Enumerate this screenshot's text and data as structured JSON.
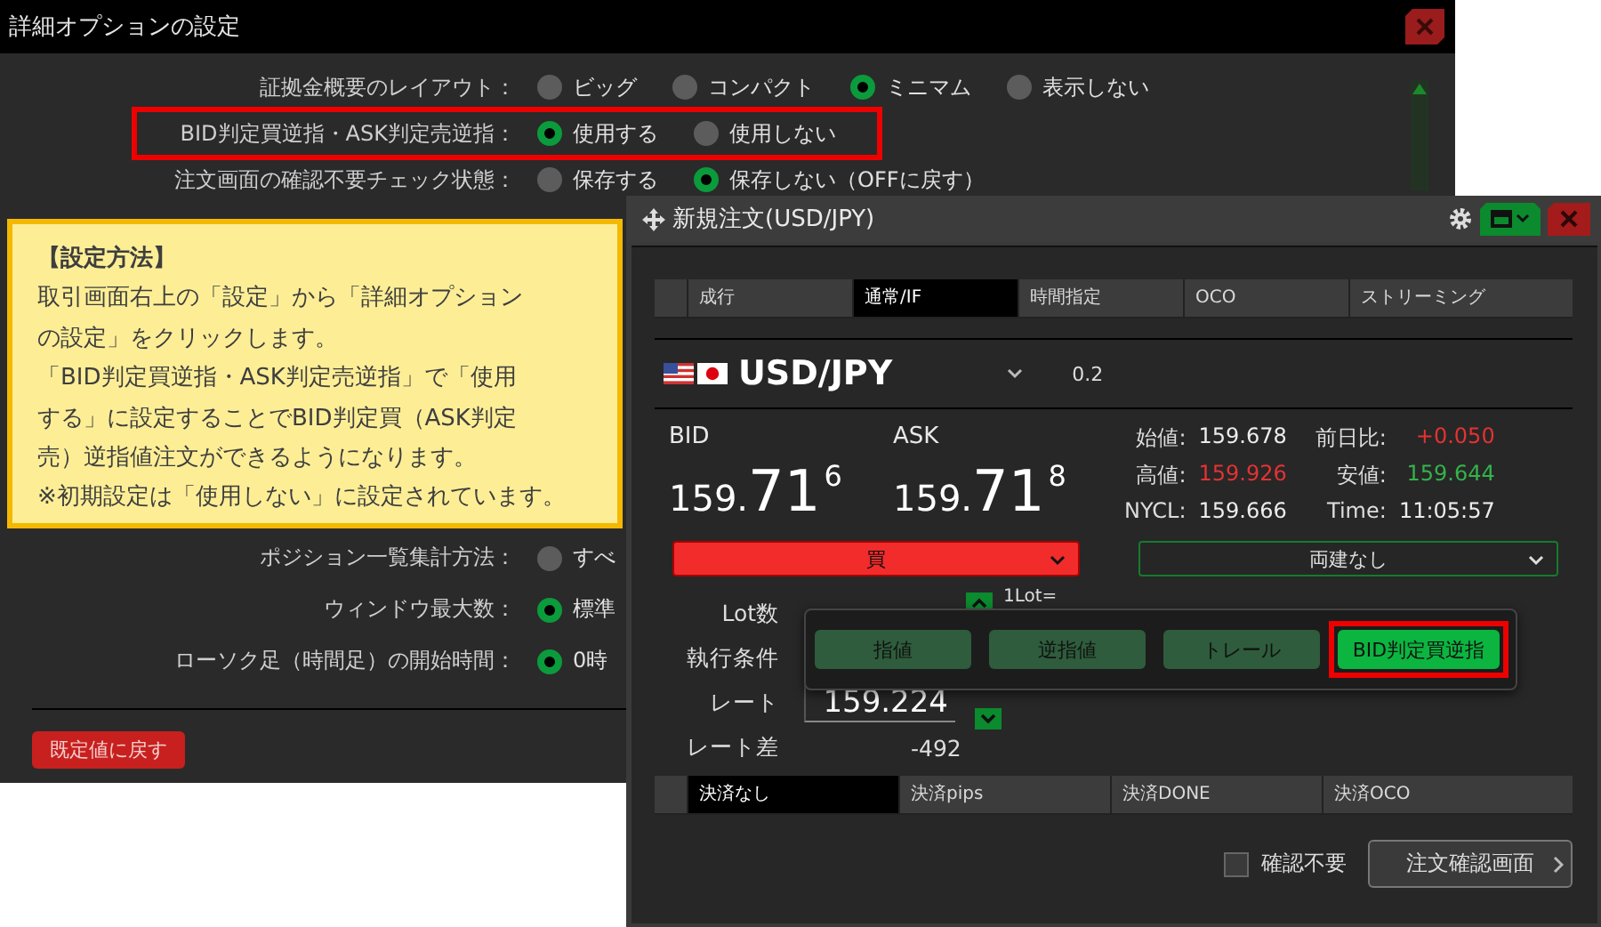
{
  "settings_window": {
    "title": "詳細オプションの設定",
    "settings": [
      {
        "label": "証拠金概要のレイアウト：",
        "highlighted": false,
        "options": [
          {
            "label": "ビッグ",
            "selected": false
          },
          {
            "label": "コンパクト",
            "selected": false
          },
          {
            "label": "ミニマム",
            "selected": true
          },
          {
            "label": "表示しない",
            "selected": false
          }
        ]
      },
      {
        "label": "BID判定買逆指・ASK判定売逆指：",
        "highlighted": true,
        "options": [
          {
            "label": "使用する",
            "selected": true
          },
          {
            "label": "使用しない",
            "selected": false
          }
        ]
      },
      {
        "label": "注文画面の確認不要チェック状態：",
        "highlighted": false,
        "options": [
          {
            "label": "保存する",
            "selected": false
          },
          {
            "label": "保存しない（OFFに戻す）",
            "selected": true
          }
        ]
      },
      {
        "label": "ポジション一覧集計方法：",
        "highlighted": false,
        "options": [
          {
            "label": "すべ",
            "selected": false
          }
        ]
      },
      {
        "label": "ウィンドウ最大数：",
        "highlighted": false,
        "options": [
          {
            "label": "標準",
            "selected": true
          }
        ]
      },
      {
        "label": "ローソク足（時間足）の開始時間：",
        "highlighted": false,
        "options": [
          {
            "label": "0時",
            "selected": true
          }
        ]
      }
    ],
    "reset_button": "既定値に戻す"
  },
  "note": {
    "heading": "【設定方法】",
    "lines": [
      "取引画面右上の「設定」から「詳細オプション",
      "の設定」をクリックします。",
      "「BID判定買逆指・ASK判定売逆指」で「使用",
      "する」に設定することでBID判定買（ASK判定",
      "売）逆指値注文ができるようになります。",
      "※初期設定は「使用しない」に設定されています。"
    ]
  },
  "order_window": {
    "title": "新規注文(USD/JPY)",
    "order_tabs": [
      {
        "label": "成行",
        "selected": false
      },
      {
        "label": "通常/IF",
        "selected": true
      },
      {
        "label": "時間指定",
        "selected": false
      },
      {
        "label": "OCO",
        "selected": false
      },
      {
        "label": "ストリーミング",
        "selected": false
      }
    ],
    "symbol": "USD/JPY",
    "spread": "0.2",
    "quotes": [
      {
        "label": "BID",
        "head": "159.",
        "big": "71",
        "pip": "6"
      },
      {
        "label": "ASK",
        "head": "159.",
        "big": "71",
        "pip": "8"
      }
    ],
    "stats": [
      {
        "label": "始値:",
        "value": "159.678",
        "color": "#ececec"
      },
      {
        "label": "前日比:",
        "value": "+0.050",
        "color": "#e53232"
      },
      {
        "label": "高値:",
        "value": "159.926",
        "color": "#e53232"
      },
      {
        "label": "安値:",
        "value": "159.644",
        "color": "#34b34a"
      },
      {
        "label": "NYCL:",
        "value": "159.666",
        "color": "#ececec"
      },
      {
        "label": "Time:",
        "value": "11:05:57",
        "color": "#ececec"
      }
    ],
    "side_select": "買",
    "hedge_select": "両建なし",
    "form": [
      {
        "kind": "lot",
        "label": "Lot数",
        "note": "1Lot="
      },
      {
        "kind": "condition",
        "label": "執行条件"
      },
      {
        "kind": "rate",
        "label": "レート",
        "value": "159.224"
      },
      {
        "kind": "diff",
        "label": "レート差",
        "value": "-492"
      }
    ],
    "settle_tabs": [
      {
        "label": "決済なし",
        "selected": true
      },
      {
        "label": "決済pips",
        "selected": false
      },
      {
        "label": "決済DONE",
        "selected": false
      },
      {
        "label": "決済OCO",
        "selected": false
      }
    ],
    "confirm_skip": {
      "label": "確認不要",
      "checked": false
    },
    "confirm_button": "注文確認画面",
    "condition_popup": [
      {
        "label": "指値",
        "selected": false,
        "highlighted": false
      },
      {
        "label": "逆指値",
        "selected": false,
        "highlighted": false
      },
      {
        "label": "トレール",
        "selected": false,
        "highlighted": false
      },
      {
        "label": "BID判定買逆指",
        "selected": true,
        "highlighted": true
      }
    ]
  }
}
